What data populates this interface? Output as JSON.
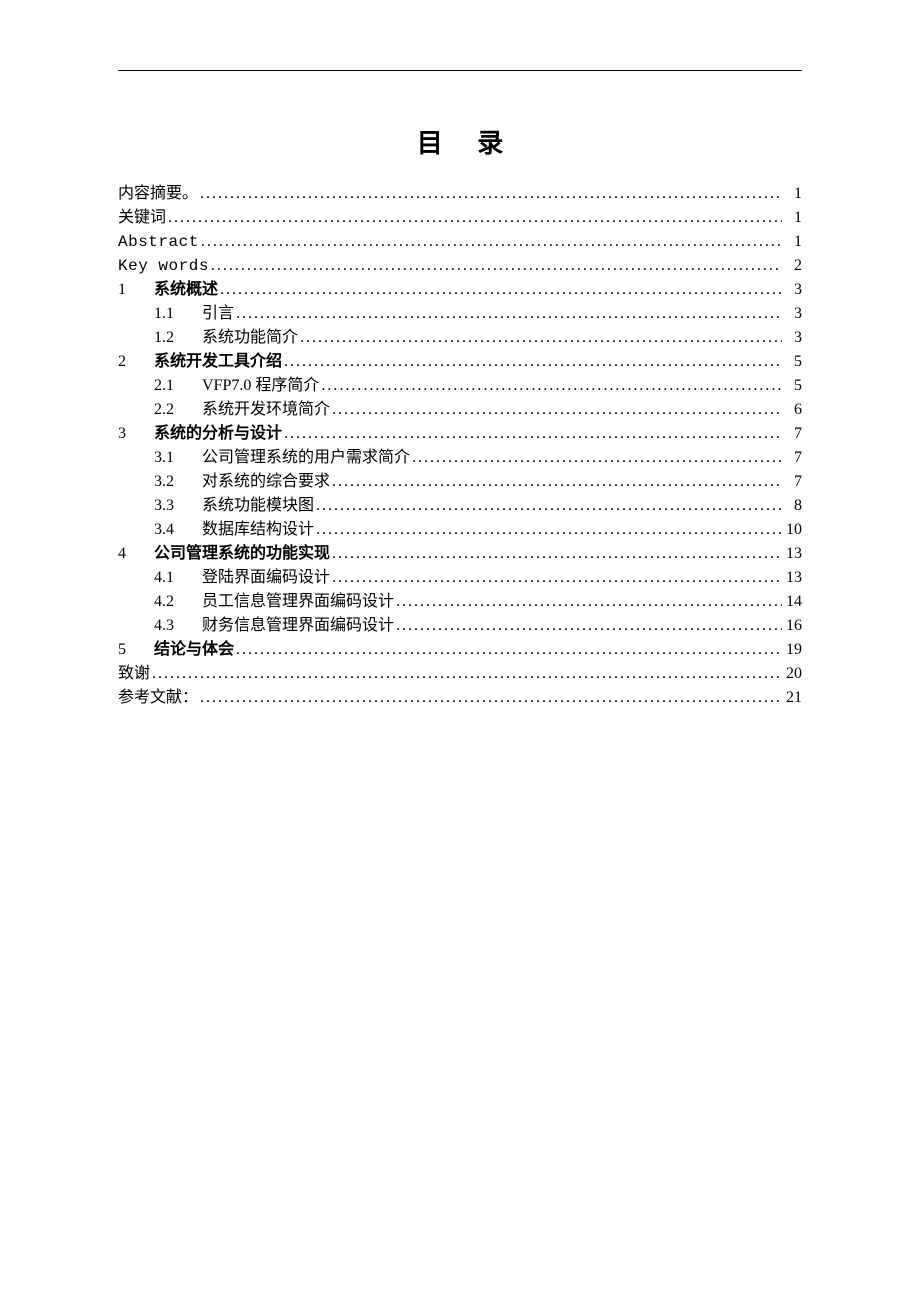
{
  "title": "目 录",
  "dots": "............................................................................................................",
  "toc": [
    {
      "indent": 0,
      "number": "",
      "label": "内容摘要。",
      "labelClass": "",
      "page": "1"
    },
    {
      "indent": 0,
      "number": "",
      "label": "关键词",
      "labelClass": "",
      "page": "1"
    },
    {
      "indent": 0,
      "number": "",
      "label": "Abstract",
      "labelClass": "mono-en",
      "page": "1"
    },
    {
      "indent": 0,
      "number": "",
      "label": "Key words",
      "labelClass": "mono-en",
      "page": "2"
    },
    {
      "indent": 1,
      "number": "1",
      "label": "系统概述",
      "labelClass": "bold",
      "page": "3"
    },
    {
      "indent": 2,
      "number": "1.1",
      "label": "引言",
      "labelClass": "",
      "page": "3"
    },
    {
      "indent": 2,
      "number": "1.2",
      "label": "系统功能简介",
      "labelClass": "",
      "page": "3"
    },
    {
      "indent": 1,
      "number": "2",
      "label": "系统开发工具介绍",
      "labelClass": "bold",
      "page": "5"
    },
    {
      "indent": 2,
      "number": "2.1",
      "label": " VFP7.0 程序简介 ",
      "labelClass": "",
      "page": "5"
    },
    {
      "indent": 2,
      "number": "2.2",
      "label": " 系统开发环境简介",
      "labelClass": "",
      "page": "6"
    },
    {
      "indent": 1,
      "number": "3",
      "label": "系统的分析与设计",
      "labelClass": "bold",
      "page": "7"
    },
    {
      "indent": 2,
      "number": "3.1",
      "label": " 公司管理系统的用户需求简介",
      "labelClass": "",
      "page": "7"
    },
    {
      "indent": 2,
      "number": "3.2",
      "label": " 对系统的综合要求",
      "labelClass": "",
      "page": "7"
    },
    {
      "indent": 2,
      "number": "3.3",
      "label": " 系统功能模块图",
      "labelClass": "",
      "page": "8"
    },
    {
      "indent": 2,
      "number": "3.4",
      "label": " 数据库结构设计",
      "labelClass": "",
      "page": "10"
    },
    {
      "indent": 1,
      "number": "4",
      "label": "公司管理系统的功能实现",
      "labelClass": "bold",
      "page": "13"
    },
    {
      "indent": 2,
      "number": "4.1",
      "label": "登陆界面编码设计",
      "labelClass": "",
      "page": "13"
    },
    {
      "indent": 2,
      "number": "4.2",
      "label": "员工信息管理界面编码设计",
      "labelClass": "",
      "page": "14"
    },
    {
      "indent": 2,
      "number": "4.3",
      "label": "财务信息管理界面编码设计",
      "labelClass": "",
      "page": "16"
    },
    {
      "indent": 1,
      "number": "5",
      "label": "结论与体会",
      "labelClass": "bold",
      "page": "19"
    },
    {
      "indent": 0,
      "number": "",
      "label": "致谢",
      "labelClass": "",
      "page": "20"
    },
    {
      "indent": 0,
      "number": "",
      "label": "参考文献：",
      "labelClass": "",
      "page": "21"
    }
  ]
}
